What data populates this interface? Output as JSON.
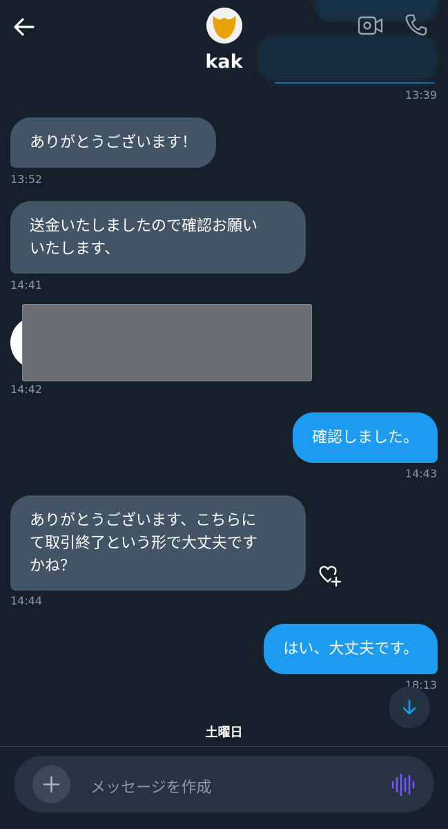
{
  "header": {
    "contact_name": "kak",
    "back_icon": "arrow-left-icon",
    "video_icon": "video-call-icon",
    "phone_icon": "phone-icon"
  },
  "messages": [
    {
      "direction": "out",
      "time": "13:39"
    },
    {
      "direction": "in",
      "text": "ありがとうございます！",
      "time": "13:52"
    },
    {
      "direction": "in",
      "lines": [
        "送金いたしましたので確認お願い",
        "いたします、"
      ],
      "time": "14:41"
    },
    {
      "direction": "in",
      "type": "image",
      "time": "14:42"
    },
    {
      "direction": "out",
      "text": "確認しました。",
      "time": "14:43"
    },
    {
      "direction": "in",
      "lines": [
        "ありがとうございます、こちらに",
        "て取引終了という形で大丈夫です",
        "かね？"
      ],
      "time": "14:44"
    },
    {
      "direction": "out",
      "text": "はい、大丈夫です。",
      "time": "18:13"
    }
  ],
  "icons": {
    "react": "heart-plus-icon",
    "scroll": "arrow-down-icon",
    "add": "plus-icon",
    "voice": "voice-wave-icon"
  },
  "day_separator": "土曜日",
  "composer": {
    "placeholder": "メッセージを作成"
  },
  "colors": {
    "background": "#16202b",
    "incoming_bubble": "#425466",
    "outgoing_bubble": "#1d9bf0",
    "timestamp": "#8b98a5",
    "voice_accent": "#7856ff"
  }
}
